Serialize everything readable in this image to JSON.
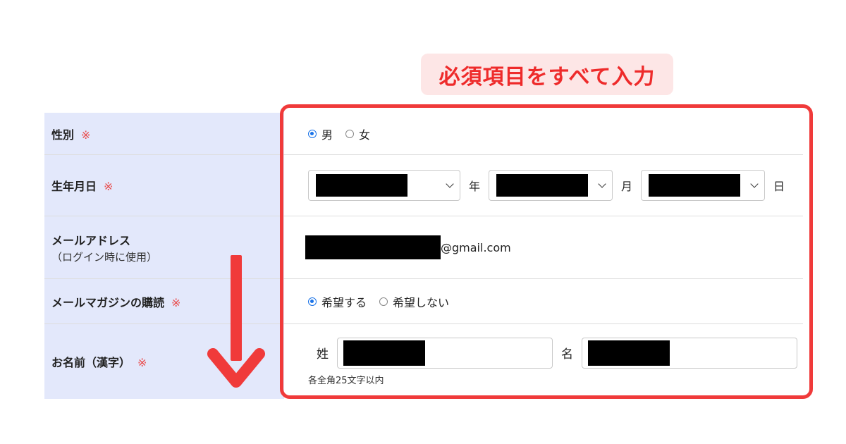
{
  "callout": "必須項目をすべて入力",
  "colors": {
    "accent_red": "#f03a3a",
    "label_bg": "#e3e8fb",
    "radio_blue": "#1a73e8",
    "callout_bg": "#fde6e6"
  },
  "form": {
    "required_mark": "※",
    "gender": {
      "label": "性別",
      "options": [
        "男",
        "女"
      ],
      "selected": "男"
    },
    "birthday": {
      "label": "生年月日",
      "year_unit": "年",
      "month_unit": "月",
      "day_unit": "日"
    },
    "email": {
      "label": "メールアドレス",
      "sublabel": "（ログイン時に使用）",
      "domain": "@gmail.com"
    },
    "newsletter": {
      "label": "メールマガジンの購読",
      "options": [
        "希望する",
        "希望しない"
      ],
      "selected": "希望する"
    },
    "name_kanji": {
      "label": "お名前（漢字）",
      "last_label": "姓",
      "first_label": "名",
      "note": "各全角25文字以内"
    }
  },
  "icons": {
    "arrow": "arrow-down-icon",
    "chevron": "chevron-down-icon",
    "radio": "radio-button-icon"
  }
}
